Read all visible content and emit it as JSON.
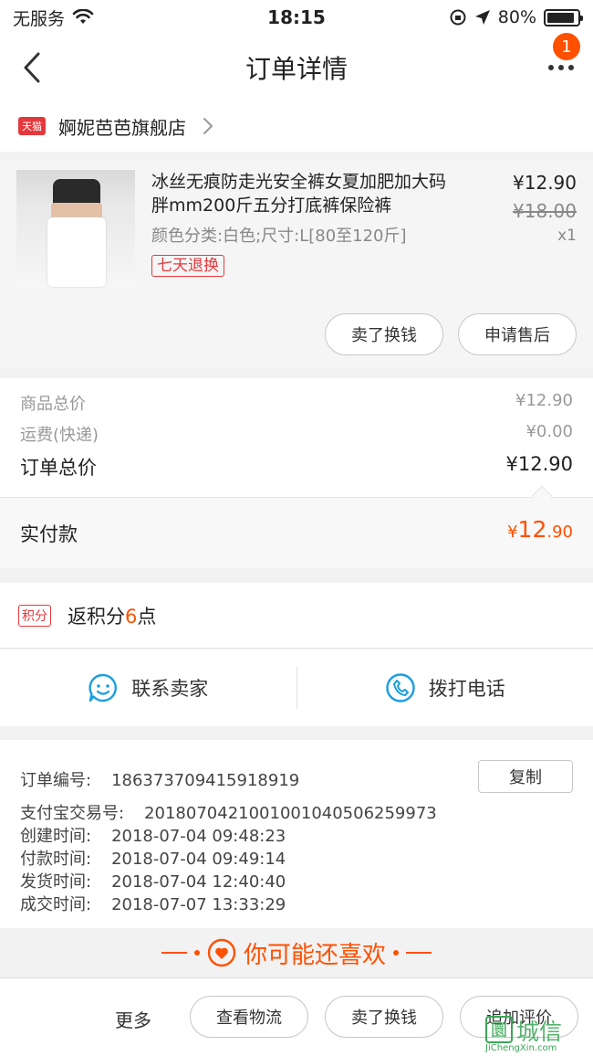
{
  "status_bar": {
    "carrier": "无服务",
    "time": "18:15",
    "battery": "80%"
  },
  "nav": {
    "title": "订单详情",
    "badge": "1"
  },
  "store": {
    "tmall_logo": "天猫",
    "name": "婀妮芭芭旗舰店"
  },
  "product": {
    "title_line1": "冰丝无痕防走光安全裤女夏加肥加大码",
    "title_line2": "胖mm200斤五分打底裤保险裤",
    "sku": "颜色分类:白色;尺寸:L[80至120斤]",
    "tag": "七天退换",
    "price": "¥12.90",
    "original_price": "¥18.00",
    "qty": "x1",
    "actions": {
      "sell": "卖了换钱",
      "after_sale": "申请售后"
    }
  },
  "totals": {
    "goods_label": "商品总价",
    "goods_value": "¥12.90",
    "shipping_label": "运费(快递)",
    "shipping_value": "¥0.00",
    "order_label": "订单总价",
    "order_value": "¥12.90",
    "paid_label": "实付款",
    "paid_currency": "¥",
    "paid_main": "12",
    "paid_decimal": ".90"
  },
  "points": {
    "tag": "积分",
    "text_before": "返积分",
    "num": "6",
    "text_after": "点"
  },
  "contact": {
    "seller": "联系卖家",
    "phone": "拨打电话"
  },
  "info": {
    "order_no_label": "订单编号:",
    "order_no": "186373709415918919",
    "copy": "复制",
    "alipay_label": "支付宝交易号:",
    "alipay_no": "2018070421001001040506259973",
    "created_label": "创建时间:",
    "created": "2018-07-04 09:48:23",
    "paid_label": "付款时间:",
    "paid": "2018-07-04 09:49:14",
    "shipped_label": "发货时间:",
    "shipped": "2018-07-04 12:40:40",
    "done_label": "成交时间:",
    "done": "2018-07-07 13:33:29"
  },
  "recommend": {
    "text": "你可能还喜欢"
  },
  "bottom": {
    "more": "更多",
    "logistics": "查看物流",
    "sell": "卖了换钱",
    "review": "追加评价"
  },
  "watermark": {
    "box": "圜",
    "text": "城信",
    "sub": "JiChengXin.com"
  },
  "colors": {
    "accent": "#ff5000",
    "tmall_red": "#e4393c",
    "icon_blue": "#1a9ee0"
  }
}
